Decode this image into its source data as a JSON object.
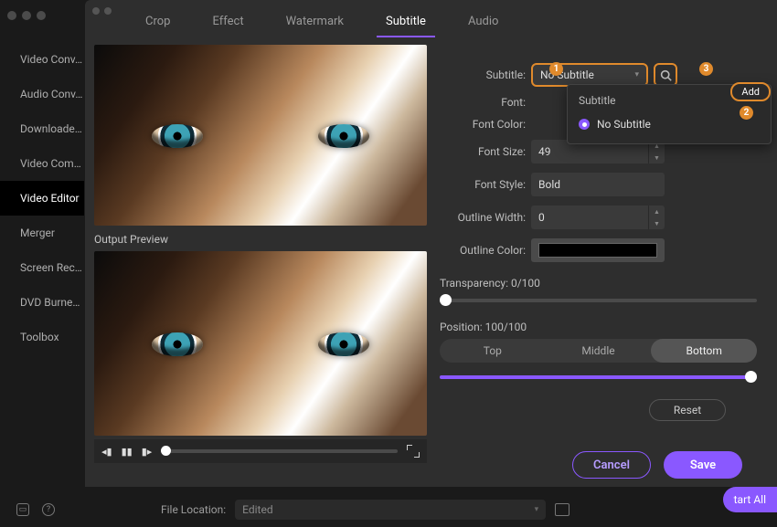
{
  "sidebar": {
    "items": [
      {
        "label": "Video Conv…"
      },
      {
        "label": "Audio Conv…"
      },
      {
        "label": "Downloade…"
      },
      {
        "label": "Video Com…"
      },
      {
        "label": "Video Editor"
      },
      {
        "label": "Merger"
      },
      {
        "label": "Screen Rec…"
      },
      {
        "label": "DVD Burne…"
      },
      {
        "label": "Toolbox"
      }
    ],
    "active_index": 4
  },
  "file_location": {
    "label": "File Location:",
    "value": "Edited"
  },
  "start_button": "tart All",
  "tabs": {
    "items": [
      "Crop",
      "Effect",
      "Watermark",
      "Subtitle",
      "Audio"
    ],
    "active_index": 3
  },
  "preview": {
    "output_label": "Output Preview"
  },
  "subtitle_panel": {
    "subtitle_label": "Subtitle:",
    "subtitle_value": "No Subtitle",
    "font_label": "Font:",
    "font_color_label": "Font Color:",
    "font_size_label": "Font Size:",
    "font_size_value": "49",
    "font_style_label": "Font Style:",
    "font_style_value": "Bold",
    "outline_width_label": "Outline Width:",
    "outline_width_value": "0",
    "outline_color_label": "Outline Color:",
    "outline_color_value": "#000000",
    "transparency_label": "Transparency: 0/100",
    "transparency_value": 0,
    "position_label": "Position: 100/100",
    "position_value": 100,
    "position_options": [
      "Top",
      "Middle",
      "Bottom"
    ],
    "position_selected": "Bottom",
    "reset_label": "Reset"
  },
  "dropdown": {
    "title": "Subtitle",
    "item": "No Subtitle",
    "add_label": "Add"
  },
  "footer": {
    "cancel": "Cancel",
    "save": "Save"
  },
  "annotations": {
    "a1": "1",
    "a2": "2",
    "a3": "3"
  }
}
